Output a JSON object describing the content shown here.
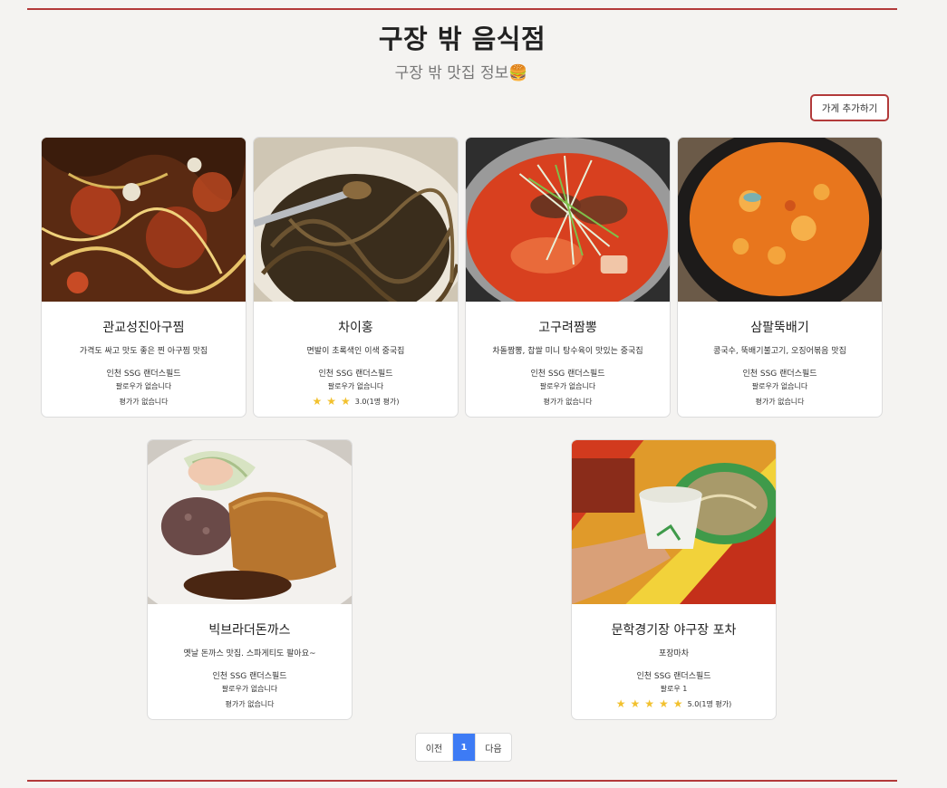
{
  "header": {
    "title": "구장 밖 음식점",
    "subtitle": "구장 밖 맛집 정보🍔",
    "add_button": "가게 추가하기"
  },
  "stores": [
    {
      "name": "관교성진아구찜",
      "description": "가격도 싸고 맛도 좋은 찐 아구찜 맛집",
      "location": "인천 SSG 랜더스필드",
      "followers": "팔로우가 없습니다",
      "rating_text": "평가가 없습니다",
      "image": "braised-monkfish-photo"
    },
    {
      "name": "차이홍",
      "description": "면발이 초록색인 이색 중국집",
      "location": "인천 SSG 랜더스필드",
      "followers": "팔로우가 없습니다",
      "rating_text": "3.0(1명 평가)",
      "stars": 3,
      "image": "jjajangmyeon-photo"
    },
    {
      "name": "고구려짬뽕",
      "description": "차돌짬뽕, 찹쌀 미니 탕수육이 맛있는 중국집",
      "location": "인천 SSG 랜더스필드",
      "followers": "팔로우가 없습니다",
      "rating_text": "평가가 없습니다",
      "image": "jjamppong-photo"
    },
    {
      "name": "삼팔뚝배기",
      "description": "콩국수, 뚝배기불고기, 오징어볶음 맛집",
      "location": "인천 SSG 랜더스필드",
      "followers": "팔로우가 없습니다",
      "rating_text": "평가가 없습니다",
      "image": "sundubu-stew-photo"
    },
    {
      "name": "빅브라더돈까스",
      "description": "옛날 돈까스 맛집. 스파게티도 팔아요~",
      "location": "인천 SSG 랜더스필드",
      "followers": "팔로우가 없습니다",
      "rating_text": "평가가 없습니다",
      "image": "pork-cutlet-photo"
    },
    {
      "name": "문학경기장 야구장 포차",
      "description": "포장마차",
      "location": "인천 SSG 랜더스필드",
      "followers": "팔로우 1",
      "rating_text": "5.0(1명 평가)",
      "stars": 5,
      "image": "pocha-makgeolli-photo"
    }
  ],
  "pagination": {
    "prev": "이전",
    "current": "1",
    "next": "다음"
  },
  "colors": {
    "accent": "#b23a3a",
    "page_active": "#3d7bf5",
    "star": "#f2c12e"
  }
}
